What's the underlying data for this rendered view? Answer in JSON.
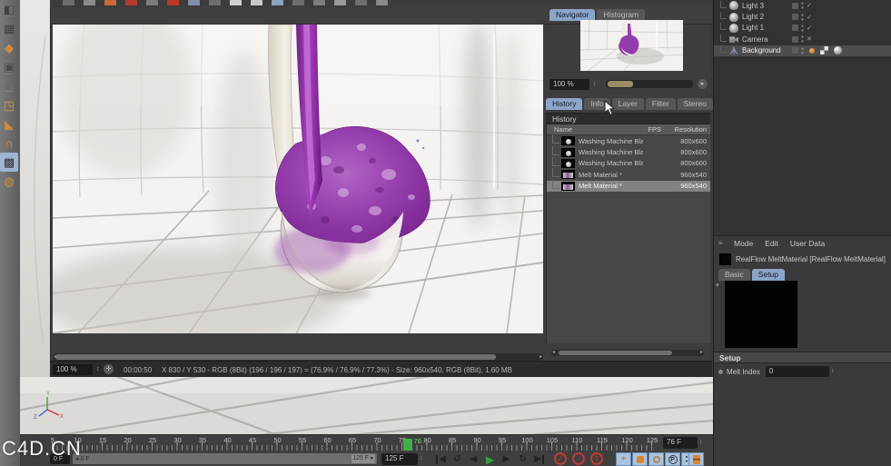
{
  "watermark": "C4D.CN",
  "top_strip": {
    "cells": [
      "#6e6e6e",
      "#8a8a8a",
      "#c96a3a",
      "#b33c2e",
      "#7d7d7d",
      "#c0392b",
      "#7f90a8",
      "#6e6e6e",
      "#d0d0d0",
      "#c9c9c9",
      "#8ba3c0",
      "#6e6e6e",
      "#7d7d7d",
      "#9a9a9a",
      "#6e6e6e",
      "#8a8a8a"
    ]
  },
  "left_toolbar": {
    "icons": [
      {
        "name": "make-editable-icon",
        "glyph": "◧",
        "tint": "#44423e",
        "active": false
      },
      {
        "name": "texture-mode-icon",
        "glyph": "▦",
        "tint": "#3f3d3a",
        "active": false
      },
      {
        "name": "workplane-mode-icon",
        "glyph": "◆",
        "tint": "#d08a3a",
        "active": false
      },
      {
        "name": "model-mode-icon",
        "glyph": "▣",
        "tint": "#4a4a4a",
        "active": false
      },
      {
        "name": "points-mode-icon",
        "glyph": "◼",
        "tint": "#6b6b6b",
        "active": false
      },
      {
        "name": "edges-mode-icon",
        "glyph": "◳",
        "tint": "#d08a3a",
        "active": false
      },
      {
        "name": "polygons-mode-icon",
        "glyph": "◣",
        "tint": "#d08a3a",
        "active": false
      },
      {
        "name": "snap-magnet-icon",
        "glyph": "∩",
        "tint": "#d08a3a",
        "active": false
      },
      {
        "name": "workplane-lock-icon",
        "glyph": "▩",
        "tint": "#2e2e2e",
        "active": true
      },
      {
        "name": "viewport-filter-icon",
        "glyph": "◍",
        "tint": "#c98a3a",
        "active": false
      }
    ]
  },
  "picture_viewer": {
    "nav_tabs": [
      {
        "label": "Navigator",
        "active": true
      },
      {
        "label": "Histogram",
        "active": false
      }
    ],
    "zoom_field": "100 %",
    "detail_tabs": [
      {
        "label": "History",
        "active": true
      },
      {
        "label": "Info",
        "active": false
      },
      {
        "label": "Layer",
        "active": false
      },
      {
        "label": "Filter",
        "active": false
      },
      {
        "label": "Stereo",
        "active": false
      }
    ],
    "history": {
      "section_title": "History",
      "columns": {
        "name": "Name",
        "fps": "FPS",
        "resolution": "Resolution"
      },
      "rows": [
        {
          "name": "Washing Machine Blank *",
          "fps": "",
          "resolution": "800x600",
          "thumb": "sphere",
          "selected": false
        },
        {
          "name": "Washing Machine Blank *",
          "fps": "",
          "resolution": "800x600",
          "thumb": "sphere",
          "selected": false
        },
        {
          "name": "Washing Machine Blank *",
          "fps": "",
          "resolution": "800x600",
          "thumb": "sphere",
          "selected": false
        },
        {
          "name": "Melt Material *",
          "fps": "",
          "resolution": "960x540",
          "thumb": "wide",
          "selected": false
        },
        {
          "name": "Melt Material *",
          "fps": "",
          "resolution": "960x540",
          "thumb": "wide",
          "selected": true
        }
      ]
    },
    "status": {
      "zoom_field": "100 %",
      "time": "00:00:50",
      "pixel_info": "X 830 / Y 530 - RGB (8Bit) (196 / 196 / 197) = (76.9% / 76.9% / 77.3%) - Size: 960x540, RGB (8Bit), 1.60 MB"
    }
  },
  "object_manager": {
    "items": [
      {
        "label": "Light 3",
        "icon": "light-icon",
        "toggles": "check",
        "selected": false
      },
      {
        "label": "Light 2",
        "icon": "light-icon",
        "toggles": "check",
        "selected": false
      },
      {
        "label": "Light 1",
        "icon": "light-icon",
        "toggles": "check",
        "selected": false
      },
      {
        "label": "Camera",
        "icon": "camera-icon",
        "toggles": "cross",
        "selected": false
      },
      {
        "label": "Background",
        "icon": "background-icon",
        "toggles": "tags",
        "selected": true
      }
    ],
    "check_glyph": "✓",
    "cross_glyph": "✕"
  },
  "attribute_manager": {
    "menu": [
      "Mode",
      "Edit",
      "User Data"
    ],
    "title": "RealFlow MeltMaterial [RealFlow MeltMaterial]",
    "tabs": [
      {
        "label": "Basic",
        "active": false
      },
      {
        "label": "Setup",
        "active": true
      }
    ],
    "section_title": "Setup",
    "fields": [
      {
        "label": "Melt Index",
        "value": "0"
      }
    ]
  },
  "timeline": {
    "ruler_labels": [
      "0",
      "5",
      "10",
      "15",
      "20",
      "25",
      "30",
      "35",
      "40",
      "45",
      "50",
      "55",
      "60",
      "65",
      "70",
      "75",
      "80",
      "85",
      "90",
      "95",
      "100",
      "105",
      "110",
      "115",
      "120",
      "125"
    ],
    "frame_min": 0,
    "frame_max": 125,
    "current_frame": "76",
    "current_frame_field": "76 F",
    "range_start_field": "0 F",
    "range_start_label": "◂ 0 F",
    "range_end_label": "125 F ▸",
    "duration_field": "125 F"
  },
  "transport": {
    "buttons": [
      {
        "name": "goto-start-button",
        "glyph": "◀",
        "bar": "left"
      },
      {
        "name": "play-backwards-button",
        "glyph": "↺"
      },
      {
        "name": "previous-frame-button",
        "glyph": "◀"
      },
      {
        "name": "play-forwards-button",
        "glyph": "▶",
        "play": true
      },
      {
        "name": "next-frame-button",
        "glyph": "▶"
      },
      {
        "name": "loop-mode-button",
        "glyph": "↻"
      },
      {
        "name": "goto-end-button",
        "glyph": "▶",
        "bar": "right"
      }
    ],
    "record_buttons": [
      {
        "name": "record-keyframe-button",
        "glyph": "⟋"
      },
      {
        "name": "autokey-button",
        "glyph": "◦"
      },
      {
        "name": "keyframe-selection-button",
        "glyph": "?"
      }
    ],
    "key_buttons": [
      {
        "name": "record-position-button",
        "kind": "plus"
      },
      {
        "name": "record-scale-button",
        "kind": "sq"
      },
      {
        "name": "record-rotation-button",
        "kind": "ring"
      },
      {
        "name": "record-parameter-button",
        "kind": "pc",
        "glyph": "P"
      },
      {
        "name": "record-pla-button",
        "kind": "dots"
      }
    ],
    "extra_button": {
      "name": "keyframe-presets-button",
      "kind": "bars"
    }
  }
}
